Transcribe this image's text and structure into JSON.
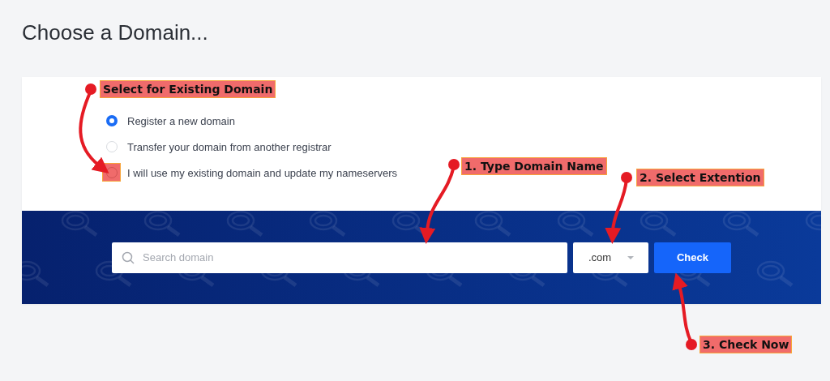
{
  "page_title": "Choose a Domain...",
  "options": [
    {
      "label": "Register a new domain",
      "selected": true
    },
    {
      "label": "Transfer your domain from another registrar",
      "selected": false
    },
    {
      "label": "I will use my existing domain and update my nameservers",
      "selected": false
    }
  ],
  "search": {
    "placeholder": "Search domain"
  },
  "extension": {
    "value": ".com"
  },
  "check_button": "Check",
  "annotations": [
    {
      "text": "Select for Existing Domain"
    },
    {
      "text": "1. Type Domain Name"
    },
    {
      "text": "2. Select Extention"
    },
    {
      "text": "3. Check Now"
    }
  ]
}
